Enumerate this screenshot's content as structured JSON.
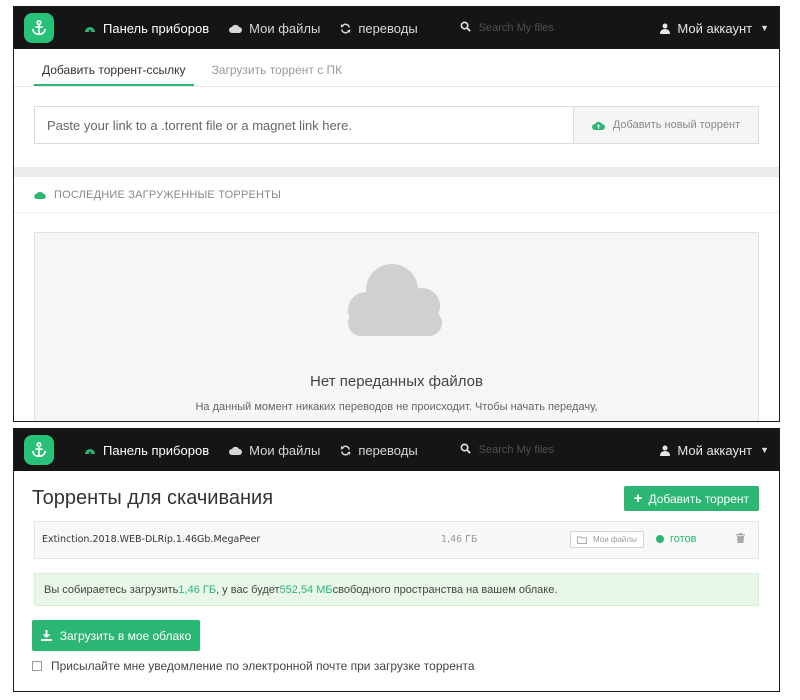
{
  "navbar": {
    "dashboard": "Панель приборов",
    "my_files": "Мои файлы",
    "transfers": "переводы",
    "search_placeholder": "Search My files",
    "account": "Мой аккаунт"
  },
  "panel1": {
    "tabs": [
      {
        "label": "Добавить торрент-ссылку",
        "active": true
      },
      {
        "label": "Загрузить торрент с ПК",
        "active": false
      }
    ],
    "link_placeholder": "Paste your link to a .torrent file or a magnet link here.",
    "add_button": "Добавить новый торрент",
    "recent_header": "ПОСЛЕДНИЕ ЗАГРУЖЕННЫЕ ТОРРЕНТЫ",
    "empty_title": "Нет переданных файлов",
    "empty_subtitle": "На данный момент никаких переводов не происходит. Чтобы начать передачу,"
  },
  "panel2": {
    "title": "Торренты для скачивания",
    "add_button": "Добавить торрент",
    "file": {
      "name": "Extinction.2018.WEB-DLRip.1.46Gb.MegaPeer",
      "size": "1,46 ГБ",
      "my_files_button": "Мои файлы",
      "status": "готов"
    },
    "notice": {
      "part1": "Вы собираетесь загрузить ",
      "size": "1,46 ГБ",
      "part2": " , у вас будет ",
      "free": "552,54 МБ",
      "part3": " свободного пространства на вашем облаке."
    },
    "upload_button": "Загрузить в мое облако",
    "notify_label": "Присылайте мне уведомление по электронной почте при загрузке торрента"
  },
  "colors": {
    "accent": "#2bb673",
    "navbar": "#151515",
    "notice_bg": "#e9f7e9"
  },
  "icons": [
    "anchor-icon",
    "dashboard-icon",
    "cloud-icon",
    "refresh-icon",
    "search-icon",
    "user-icon",
    "caret-down-icon",
    "cloud-upload-icon",
    "folder-icon",
    "trash-icon",
    "download-icon",
    "plus-icon"
  ]
}
